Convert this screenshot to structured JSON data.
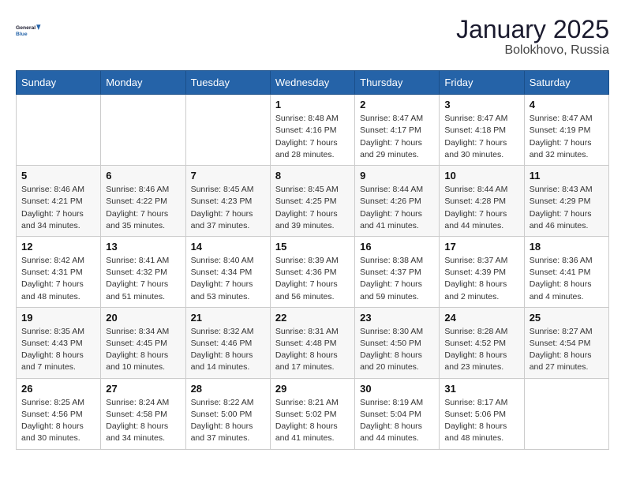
{
  "logo": {
    "line1": "General",
    "line2": "Blue"
  },
  "title": "January 2025",
  "subtitle": "Bolokhovo, Russia",
  "days_of_week": [
    "Sunday",
    "Monday",
    "Tuesday",
    "Wednesday",
    "Thursday",
    "Friday",
    "Saturday"
  ],
  "weeks": [
    [
      {
        "day": "",
        "detail": ""
      },
      {
        "day": "",
        "detail": ""
      },
      {
        "day": "",
        "detail": ""
      },
      {
        "day": "1",
        "detail": "Sunrise: 8:48 AM\nSunset: 4:16 PM\nDaylight: 7 hours\nand 28 minutes."
      },
      {
        "day": "2",
        "detail": "Sunrise: 8:47 AM\nSunset: 4:17 PM\nDaylight: 7 hours\nand 29 minutes."
      },
      {
        "day": "3",
        "detail": "Sunrise: 8:47 AM\nSunset: 4:18 PM\nDaylight: 7 hours\nand 30 minutes."
      },
      {
        "day": "4",
        "detail": "Sunrise: 8:47 AM\nSunset: 4:19 PM\nDaylight: 7 hours\nand 32 minutes."
      }
    ],
    [
      {
        "day": "5",
        "detail": "Sunrise: 8:46 AM\nSunset: 4:21 PM\nDaylight: 7 hours\nand 34 minutes."
      },
      {
        "day": "6",
        "detail": "Sunrise: 8:46 AM\nSunset: 4:22 PM\nDaylight: 7 hours\nand 35 minutes."
      },
      {
        "day": "7",
        "detail": "Sunrise: 8:45 AM\nSunset: 4:23 PM\nDaylight: 7 hours\nand 37 minutes."
      },
      {
        "day": "8",
        "detail": "Sunrise: 8:45 AM\nSunset: 4:25 PM\nDaylight: 7 hours\nand 39 minutes."
      },
      {
        "day": "9",
        "detail": "Sunrise: 8:44 AM\nSunset: 4:26 PM\nDaylight: 7 hours\nand 41 minutes."
      },
      {
        "day": "10",
        "detail": "Sunrise: 8:44 AM\nSunset: 4:28 PM\nDaylight: 7 hours\nand 44 minutes."
      },
      {
        "day": "11",
        "detail": "Sunrise: 8:43 AM\nSunset: 4:29 PM\nDaylight: 7 hours\nand 46 minutes."
      }
    ],
    [
      {
        "day": "12",
        "detail": "Sunrise: 8:42 AM\nSunset: 4:31 PM\nDaylight: 7 hours\nand 48 minutes."
      },
      {
        "day": "13",
        "detail": "Sunrise: 8:41 AM\nSunset: 4:32 PM\nDaylight: 7 hours\nand 51 minutes."
      },
      {
        "day": "14",
        "detail": "Sunrise: 8:40 AM\nSunset: 4:34 PM\nDaylight: 7 hours\nand 53 minutes."
      },
      {
        "day": "15",
        "detail": "Sunrise: 8:39 AM\nSunset: 4:36 PM\nDaylight: 7 hours\nand 56 minutes."
      },
      {
        "day": "16",
        "detail": "Sunrise: 8:38 AM\nSunset: 4:37 PM\nDaylight: 7 hours\nand 59 minutes."
      },
      {
        "day": "17",
        "detail": "Sunrise: 8:37 AM\nSunset: 4:39 PM\nDaylight: 8 hours\nand 2 minutes."
      },
      {
        "day": "18",
        "detail": "Sunrise: 8:36 AM\nSunset: 4:41 PM\nDaylight: 8 hours\nand 4 minutes."
      }
    ],
    [
      {
        "day": "19",
        "detail": "Sunrise: 8:35 AM\nSunset: 4:43 PM\nDaylight: 8 hours\nand 7 minutes."
      },
      {
        "day": "20",
        "detail": "Sunrise: 8:34 AM\nSunset: 4:45 PM\nDaylight: 8 hours\nand 10 minutes."
      },
      {
        "day": "21",
        "detail": "Sunrise: 8:32 AM\nSunset: 4:46 PM\nDaylight: 8 hours\nand 14 minutes."
      },
      {
        "day": "22",
        "detail": "Sunrise: 8:31 AM\nSunset: 4:48 PM\nDaylight: 8 hours\nand 17 minutes."
      },
      {
        "day": "23",
        "detail": "Sunrise: 8:30 AM\nSunset: 4:50 PM\nDaylight: 8 hours\nand 20 minutes."
      },
      {
        "day": "24",
        "detail": "Sunrise: 8:28 AM\nSunset: 4:52 PM\nDaylight: 8 hours\nand 23 minutes."
      },
      {
        "day": "25",
        "detail": "Sunrise: 8:27 AM\nSunset: 4:54 PM\nDaylight: 8 hours\nand 27 minutes."
      }
    ],
    [
      {
        "day": "26",
        "detail": "Sunrise: 8:25 AM\nSunset: 4:56 PM\nDaylight: 8 hours\nand 30 minutes."
      },
      {
        "day": "27",
        "detail": "Sunrise: 8:24 AM\nSunset: 4:58 PM\nDaylight: 8 hours\nand 34 minutes."
      },
      {
        "day": "28",
        "detail": "Sunrise: 8:22 AM\nSunset: 5:00 PM\nDaylight: 8 hours\nand 37 minutes."
      },
      {
        "day": "29",
        "detail": "Sunrise: 8:21 AM\nSunset: 5:02 PM\nDaylight: 8 hours\nand 41 minutes."
      },
      {
        "day": "30",
        "detail": "Sunrise: 8:19 AM\nSunset: 5:04 PM\nDaylight: 8 hours\nand 44 minutes."
      },
      {
        "day": "31",
        "detail": "Sunrise: 8:17 AM\nSunset: 5:06 PM\nDaylight: 8 hours\nand 48 minutes."
      },
      {
        "day": "",
        "detail": ""
      }
    ]
  ]
}
